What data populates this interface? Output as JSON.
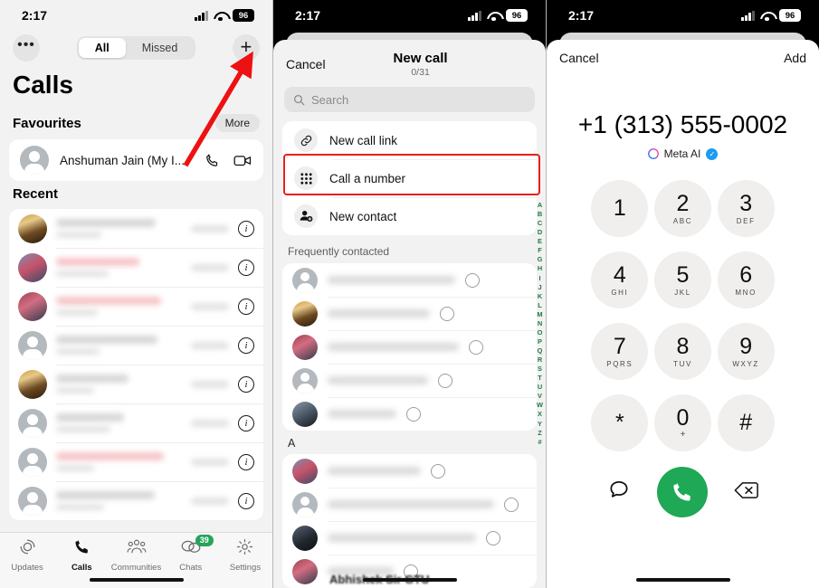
{
  "status_bar": {
    "time": "2:17",
    "battery": "96"
  },
  "panel_calls": {
    "overflow_label": "•••",
    "segments": [
      {
        "label": "All",
        "active": true
      },
      {
        "label": "Missed",
        "active": false
      }
    ],
    "add_button": "+",
    "title": "Calls",
    "favourites": {
      "heading": "Favourites",
      "more_label": "More",
      "contact_name": "Anshuman Jain (My I...",
      "voice_icon": "phone-icon",
      "video_icon": "video-camera-icon"
    },
    "recent": {
      "heading": "Recent",
      "rows": [
        {
          "avatar": "photo",
          "photo_class": "ph-1",
          "name_redacted": true,
          "name_tint": "grey",
          "info_icon": "info-icon"
        },
        {
          "avatar": "photo",
          "photo_class": "ph-2",
          "name_redacted": true,
          "name_tint": "red",
          "info_icon": "info-icon"
        },
        {
          "avatar": "photo",
          "photo_class": "ph-3",
          "name_redacted": true,
          "name_tint": "red",
          "info_icon": "info-icon"
        },
        {
          "avatar": "person",
          "photo_class": "",
          "name_redacted": true,
          "name_tint": "grey",
          "info_icon": "info-icon"
        },
        {
          "avatar": "photo",
          "photo_class": "ph-1",
          "name_redacted": true,
          "name_tint": "grey",
          "info_icon": "info-icon"
        },
        {
          "avatar": "person",
          "photo_class": "",
          "name_redacted": true,
          "name_tint": "grey",
          "info_icon": "info-icon"
        },
        {
          "avatar": "person",
          "photo_class": "",
          "name_redacted": true,
          "name_tint": "red",
          "info_icon": "info-icon"
        },
        {
          "avatar": "person",
          "photo_class": "",
          "name_redacted": true,
          "name_tint": "grey",
          "info_icon": "info-icon"
        }
      ]
    },
    "tabs": [
      {
        "label": "Updates",
        "icon": "updates-icon",
        "active": false,
        "badge": null
      },
      {
        "label": "Calls",
        "icon": "phone-icon",
        "active": true,
        "badge": null
      },
      {
        "label": "Communities",
        "icon": "communities-icon",
        "active": false,
        "badge": null
      },
      {
        "label": "Chats",
        "icon": "chats-icon",
        "active": false,
        "badge": "39"
      },
      {
        "label": "Settings",
        "icon": "gear-icon",
        "active": false,
        "badge": null
      }
    ]
  },
  "panel_new_call": {
    "cancel_label": "Cancel",
    "title": "New call",
    "counter": "0/31",
    "search_placeholder": "Search",
    "options": [
      {
        "label": "New call link",
        "icon": "link-icon",
        "highlighted": false
      },
      {
        "label": "Call a number",
        "icon": "dialpad-icon",
        "highlighted": true
      },
      {
        "label": "New contact",
        "icon": "add-person-icon",
        "highlighted": false
      }
    ],
    "frequently_heading": "Frequently contacted",
    "frequent_rows": [
      {
        "avatar": "person",
        "photo_class": ""
      },
      {
        "avatar": "photo",
        "photo_class": "ph-1"
      },
      {
        "avatar": "photo",
        "photo_class": "ph-3"
      },
      {
        "avatar": "person",
        "photo_class": ""
      },
      {
        "avatar": "photo",
        "photo_class": "ph-5"
      }
    ],
    "section_letter": "A",
    "section_rows": [
      {
        "avatar": "photo",
        "photo_class": "ph-2"
      },
      {
        "avatar": "person",
        "photo_class": ""
      },
      {
        "avatar": "photo",
        "photo_class": "ph-4"
      },
      {
        "avatar": "photo",
        "photo_class": "ph-3"
      }
    ],
    "partial_name": "Abhishek Sir GTU",
    "alphabet_index": [
      "A",
      "B",
      "C",
      "D",
      "E",
      "F",
      "G",
      "H",
      "I",
      "J",
      "K",
      "L",
      "M",
      "N",
      "O",
      "P",
      "Q",
      "R",
      "S",
      "T",
      "U",
      "V",
      "W",
      "X",
      "Y",
      "Z",
      "#"
    ],
    "index_color": "#1f7a45",
    "highlight_color": "#e81e1e"
  },
  "panel_dialer": {
    "cancel_label": "Cancel",
    "add_label": "Add",
    "number": "+1 (313) 555-0002",
    "meta_label": "Meta AI",
    "verified_icon": "verified-badge-icon",
    "keys": [
      {
        "digit": "1",
        "letters": ""
      },
      {
        "digit": "2",
        "letters": "ABC"
      },
      {
        "digit": "3",
        "letters": "DEF"
      },
      {
        "digit": "4",
        "letters": "GHI"
      },
      {
        "digit": "5",
        "letters": "JKL"
      },
      {
        "digit": "6",
        "letters": "MNO"
      },
      {
        "digit": "7",
        "letters": "PQRS"
      },
      {
        "digit": "8",
        "letters": "TUV"
      },
      {
        "digit": "9",
        "letters": "WXYZ"
      },
      {
        "digit": "*",
        "letters": ""
      },
      {
        "digit": "0",
        "letters": "+"
      },
      {
        "digit": "#",
        "letters": ""
      }
    ],
    "message_icon": "message-bubble-icon",
    "call_icon": "phone-icon",
    "backspace_icon": "backspace-icon",
    "call_button_color": "#1fa855"
  },
  "annotations": {
    "arrow_color": "#ee1111",
    "arrow_name": "red-pointer-arrow",
    "box_name": "red-highlight-box"
  }
}
